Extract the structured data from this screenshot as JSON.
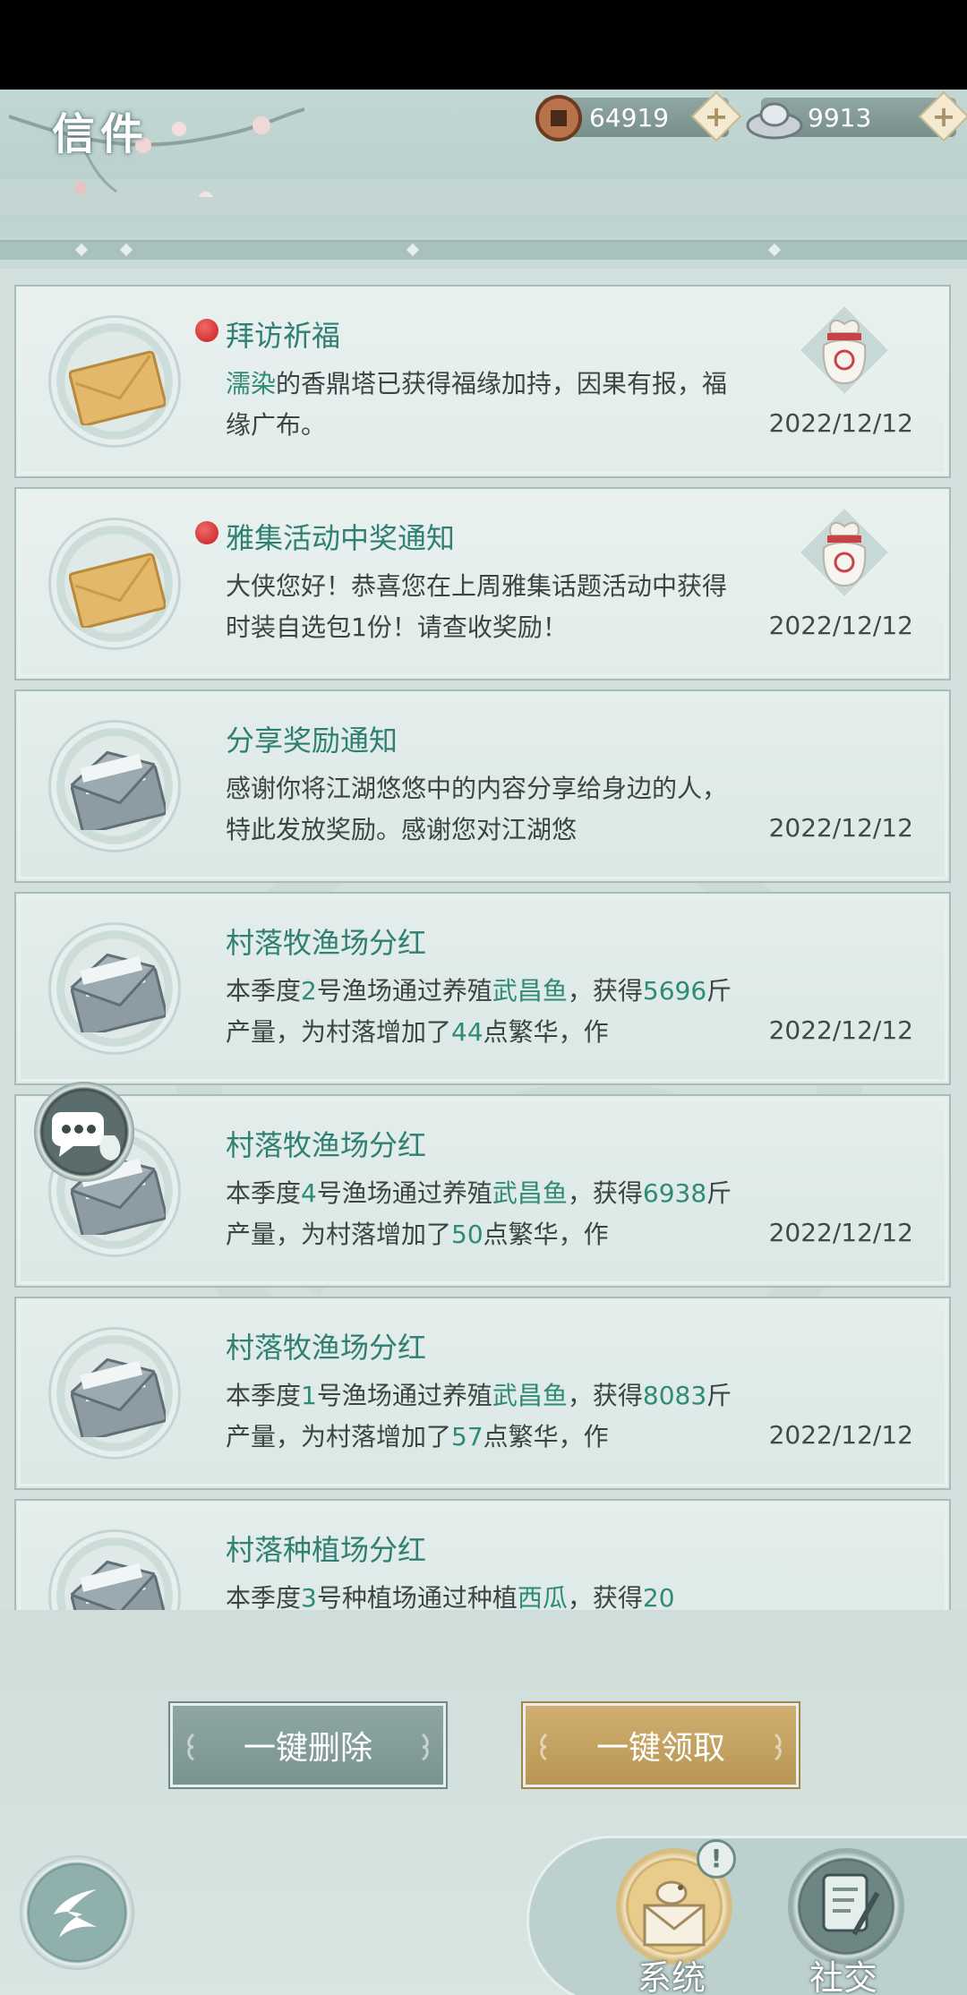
{
  "header": {
    "title": "信件",
    "copper": {
      "amount": "64919",
      "icon": "copper-coin-icon"
    },
    "silver": {
      "amount": "9913",
      "icon": "silver-ingot-icon"
    },
    "plus": "+"
  },
  "mails": [
    {
      "subject": "拜访祈福",
      "unread": true,
      "body_parts": [
        [
          "濡染",
          true
        ],
        [
          "的香鼎塔已获得福缘加持，因果有报，福缘广布。",
          false
        ]
      ],
      "date": "2022/12/12",
      "has_attachment": true
    },
    {
      "subject": "雅集活动中奖通知",
      "unread": true,
      "body_parts": [
        [
          "大侠您好！恭喜您在上周雅集话题活动中获得时装自选包1份！请查收奖励！",
          false
        ]
      ],
      "date": "2022/12/12",
      "has_attachment": true
    },
    {
      "subject": "分享奖励通知",
      "unread": false,
      "body_parts": [
        [
          "感谢你将江湖悠悠中的内容分享给身边的人，特此发放奖励。感谢您对江湖悠",
          false
        ]
      ],
      "date": "2022/12/12",
      "has_attachment": false
    },
    {
      "subject": "村落牧渔场分红",
      "unread": false,
      "body_parts": [
        [
          "本季度",
          false
        ],
        [
          "2",
          true
        ],
        [
          "号渔场通过养殖",
          false
        ],
        [
          "武昌鱼",
          true
        ],
        [
          "，获得",
          false
        ],
        [
          "5696",
          true
        ],
        [
          "斤产量，为村落增加了",
          false
        ],
        [
          "44",
          true
        ],
        [
          "点繁华，作",
          false
        ]
      ],
      "date": "2022/12/12",
      "has_attachment": false
    },
    {
      "subject": "村落牧渔场分红",
      "unread": false,
      "body_parts": [
        [
          "本季度",
          false
        ],
        [
          "4",
          true
        ],
        [
          "号渔场通过养殖",
          false
        ],
        [
          "武昌鱼",
          true
        ],
        [
          "，获得",
          false
        ],
        [
          "6938",
          true
        ],
        [
          "斤产量，为村落增加了",
          false
        ],
        [
          "50",
          true
        ],
        [
          "点繁华，作",
          false
        ]
      ],
      "date": "2022/12/12",
      "has_attachment": false
    },
    {
      "subject": "村落牧渔场分红",
      "unread": false,
      "body_parts": [
        [
          "本季度",
          false
        ],
        [
          "1",
          true
        ],
        [
          "号渔场通过养殖",
          false
        ],
        [
          "武昌鱼",
          true
        ],
        [
          "，获得",
          false
        ],
        [
          "8083",
          true
        ],
        [
          "斤产量，为村落增加了",
          false
        ],
        [
          "57",
          true
        ],
        [
          "点繁华，作",
          false
        ]
      ],
      "date": "2022/12/12",
      "has_attachment": false
    },
    {
      "subject": "村落种植场分红",
      "unread": false,
      "body_parts": [
        [
          "本季度",
          false
        ],
        [
          "3",
          true
        ],
        [
          "号种植场通过种植",
          false
        ],
        [
          "西瓜",
          true
        ],
        [
          "，获得",
          false
        ],
        [
          "20",
          true
        ]
      ],
      "date": "",
      "has_attachment": false
    }
  ],
  "actions": {
    "delete_all": "一键删除",
    "claim_all": "一键领取"
  },
  "tabs": {
    "system": "系统",
    "social": "社交",
    "system_badge": "!"
  }
}
